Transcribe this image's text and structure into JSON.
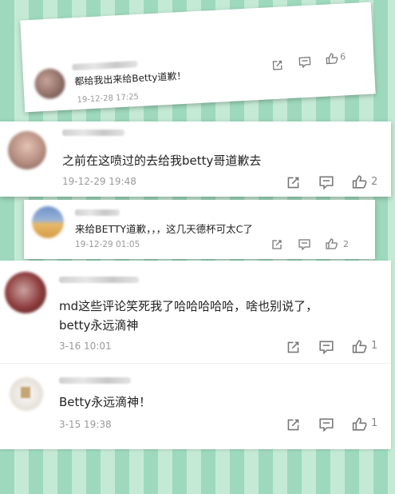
{
  "comments": [
    {
      "text_lines": [
        "都给我出来给Betty道歉！"
      ],
      "time": "19-12-28 17:25",
      "likes": "6"
    },
    {
      "text_lines": [
        "之前在这喷过的去给我betty哥道歉去"
      ],
      "time": "19-12-29 19:48",
      "likes": "2"
    },
    {
      "text_lines": [
        "来给BETTY道歉，，，这几天德杯可太C了"
      ],
      "time": "19-12-29 01:05",
      "likes": "2"
    },
    {
      "text_lines": [
        "md这些评论笑死我了哈哈哈哈哈，啥也别说了，",
        "betty永远滴神"
      ],
      "time": "3-16 10:01",
      "likes": "1"
    },
    {
      "text_lines": [
        "Betty永远滴神！"
      ],
      "time": "3-15 19:38",
      "likes": "1"
    }
  ],
  "icons": {
    "share": "share-icon",
    "reply": "comment-icon",
    "like": "thumbs-up-icon"
  }
}
